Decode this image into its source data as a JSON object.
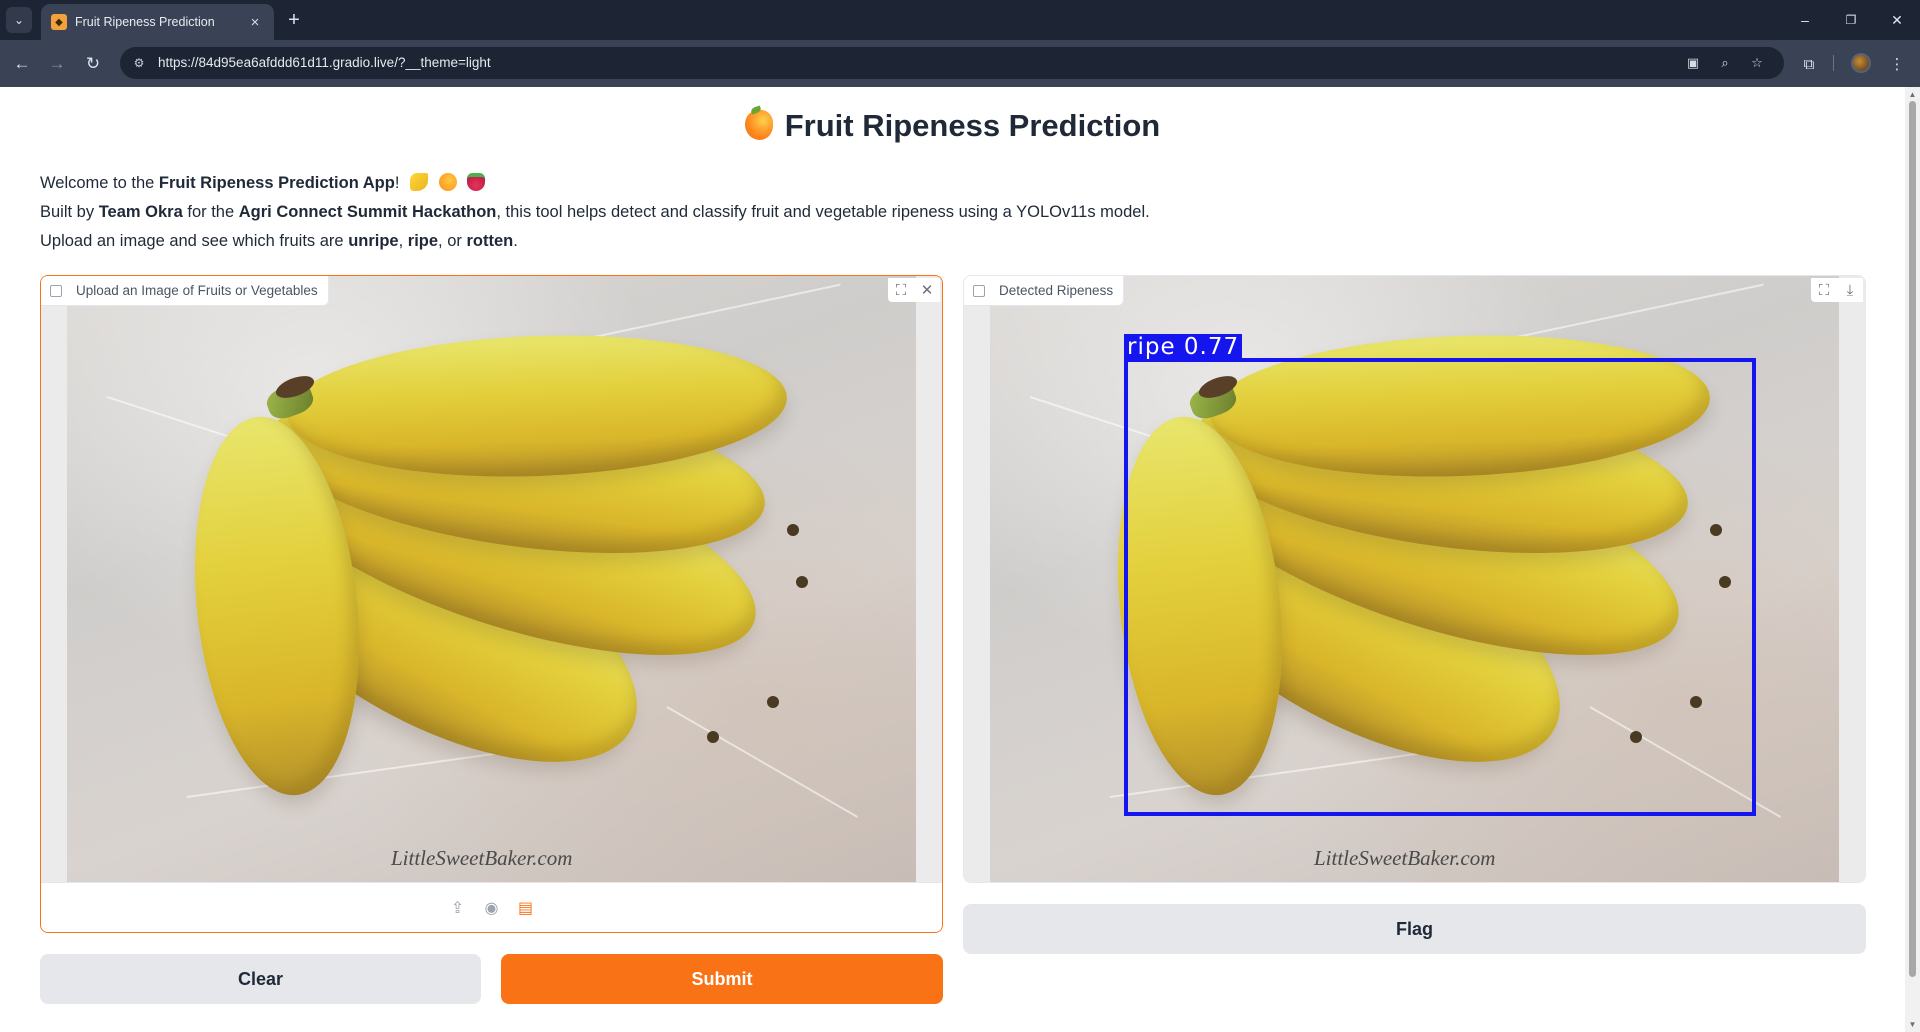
{
  "browser": {
    "tab_title": "Fruit Ripeness Prediction",
    "url": "https://84d95ea6afddd61d11.gradio.live/?__theme=light",
    "tab_close_icon": "×",
    "new_tab_icon": "+",
    "window_controls": [
      "–",
      "❐",
      "✕"
    ]
  },
  "header": {
    "title": "Fruit Ripeness Prediction"
  },
  "description": {
    "line1_prefix": "Welcome to the ",
    "line1_bold": "Fruit Ripeness Prediction App",
    "line1_suffix": "!",
    "line2_a": "Built by ",
    "line2_team": "Team Okra",
    "line2_b": " for the ",
    "line2_event": "Agri Connect Summit Hackathon",
    "line2_c": ", this tool helps detect and classify fruit and vegetable ripeness using a YOLOv11s model.",
    "line3_a": "Upload an image and see which fruits are ",
    "line3_unripe": "unripe",
    "line3_b": ", ",
    "line3_ripe": "ripe",
    "line3_c": ", or ",
    "line3_rotten": "rotten",
    "line3_d": "."
  },
  "input_panel": {
    "label": "Upload an Image of Fruits or Vegetables",
    "watermark": "LittleSweetBaker.com"
  },
  "output_panel": {
    "label": "Detected Ripeness",
    "watermark": "LittleSweetBaker.com",
    "detection": {
      "class": "ripe",
      "confidence": "0.77",
      "label_text": "ripe 0.77"
    }
  },
  "buttons": {
    "clear": "Clear",
    "submit": "Submit",
    "flag": "Flag"
  },
  "colors": {
    "accent": "#f97316",
    "detection_box": "#1515f0",
    "chrome_dark": "#1d2433"
  }
}
